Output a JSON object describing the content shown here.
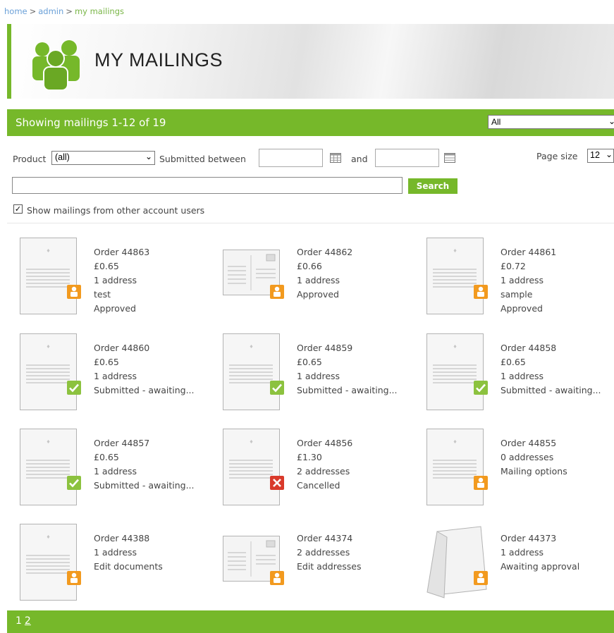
{
  "breadcrumb": {
    "home": "home",
    "admin": "admin",
    "current": "my mailings",
    "sep": ">"
  },
  "header": {
    "title": "MY MAILINGS"
  },
  "toolbar": {
    "showing": "Showing mailings 1-12 of 19",
    "filter_value": "All"
  },
  "filters": {
    "product_label": "Product",
    "product_value": "(all)",
    "submitted_label": "Submitted between",
    "and_label": "and",
    "page_size_label": "Page size",
    "page_size_value": "12",
    "search_button": "Search",
    "show_others_label": "Show mailings from other account users",
    "show_others_checked": true
  },
  "mailings": [
    {
      "order": "Order 44863",
      "lines": [
        "£0.65",
        "1 address",
        "test",
        "Approved"
      ],
      "thumb": "letter",
      "status": "pending"
    },
    {
      "order": "Order 44862",
      "lines": [
        "£0.66",
        "1 address",
        "Approved"
      ],
      "thumb": "postcard",
      "status": "pending"
    },
    {
      "order": "Order 44861",
      "lines": [
        "£0.72",
        "1 address",
        "sample",
        "Approved"
      ],
      "thumb": "letter",
      "status": "pending"
    },
    {
      "order": "Order 44860",
      "lines": [
        "£0.65",
        "1 address",
        "Submitted - awaiting..."
      ],
      "thumb": "letter",
      "status": "submitted"
    },
    {
      "order": "Order 44859",
      "lines": [
        "£0.65",
        "1 address",
        "Submitted - awaiting..."
      ],
      "thumb": "letter",
      "status": "submitted"
    },
    {
      "order": "Order 44858",
      "lines": [
        "£0.65",
        "1 address",
        "Submitted - awaiting..."
      ],
      "thumb": "letter",
      "status": "submitted"
    },
    {
      "order": "Order 44857",
      "lines": [
        "£0.65",
        "1 address",
        "Submitted - awaiting..."
      ],
      "thumb": "letter",
      "status": "submitted"
    },
    {
      "order": "Order 44856",
      "lines": [
        "£1.30",
        "2 addresses",
        "Cancelled"
      ],
      "thumb": "letter",
      "status": "cancelled"
    },
    {
      "order": "Order 44855",
      "lines": [
        "0 addresses",
        "Mailing options"
      ],
      "thumb": "letter",
      "status": "pending"
    },
    {
      "order": "Order 44388",
      "lines": [
        "1 address",
        "Edit documents"
      ],
      "thumb": "letter",
      "status": "pending"
    },
    {
      "order": "Order 44374",
      "lines": [
        "2 addresses",
        "Edit addresses"
      ],
      "thumb": "postcard",
      "status": "pending"
    },
    {
      "order": "Order 44373",
      "lines": [
        "1 address",
        "Awaiting approval"
      ],
      "thumb": "folded",
      "status": "pending"
    }
  ],
  "pager": {
    "current": "1",
    "pages": [
      "2"
    ]
  },
  "colors": {
    "brand_green": "#76b82a",
    "badge_orange": "#f29a1f",
    "badge_green": "#8cc23f",
    "badge_red": "#d93a2b"
  },
  "icons": {
    "header": "users-group-icon",
    "calendar": "calendar-icon",
    "pending": "person-icon",
    "submitted": "check-icon",
    "cancelled": "cross-icon"
  }
}
